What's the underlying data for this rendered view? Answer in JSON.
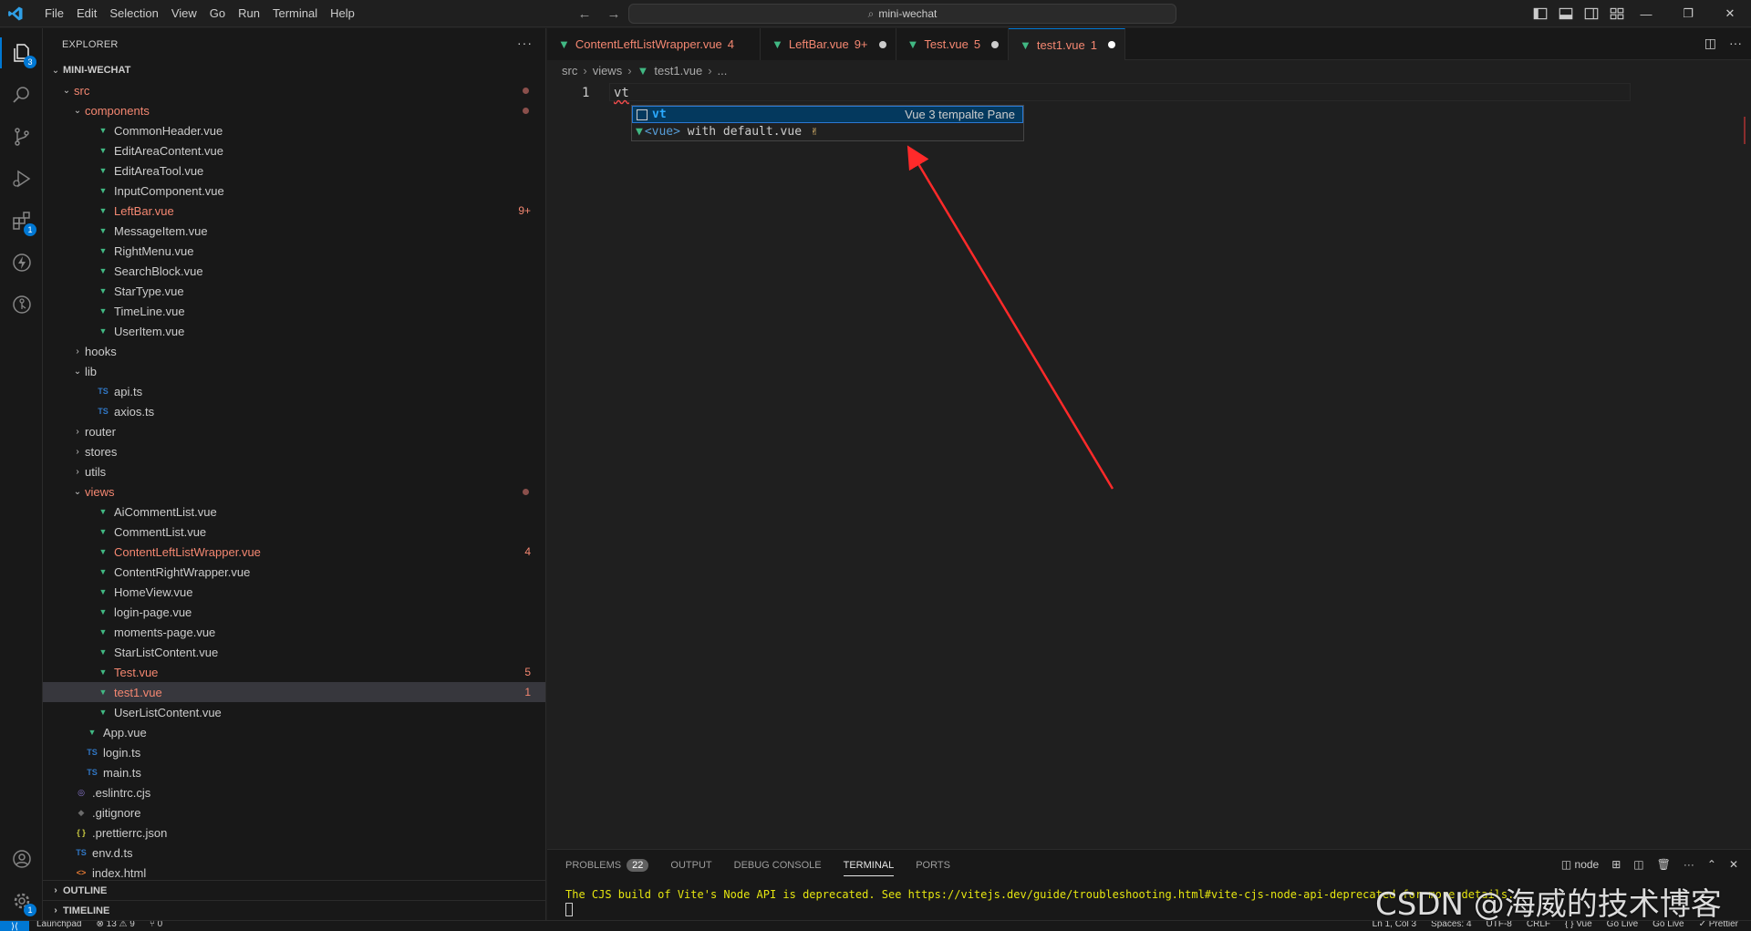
{
  "menubar": [
    "File",
    "Edit",
    "Selection",
    "View",
    "Go",
    "Run",
    "Terminal",
    "Help"
  ],
  "command_center": {
    "text": "mini-wechat"
  },
  "activity_badges": {
    "explorer": "3",
    "extensions": "1"
  },
  "explorer": {
    "title": "EXPLORER",
    "more": "···",
    "project": "MINI-WECHAT",
    "rows": [
      {
        "label": "src",
        "indent": 1,
        "kind": "folder-open",
        "err": true,
        "dot": true
      },
      {
        "label": "components",
        "indent": 2,
        "kind": "folder-open",
        "err": true,
        "dot": true
      },
      {
        "label": "CommonHeader.vue",
        "indent": 3,
        "kind": "vue"
      },
      {
        "label": "EditAreaContent.vue",
        "indent": 3,
        "kind": "vue"
      },
      {
        "label": "EditAreaTool.vue",
        "indent": 3,
        "kind": "vue"
      },
      {
        "label": "InputComponent.vue",
        "indent": 3,
        "kind": "vue"
      },
      {
        "label": "LeftBar.vue",
        "indent": 3,
        "kind": "vue",
        "err": true,
        "badge": "9+"
      },
      {
        "label": "MessageItem.vue",
        "indent": 3,
        "kind": "vue"
      },
      {
        "label": "RightMenu.vue",
        "indent": 3,
        "kind": "vue"
      },
      {
        "label": "SearchBlock.vue",
        "indent": 3,
        "kind": "vue"
      },
      {
        "label": "StarType.vue",
        "indent": 3,
        "kind": "vue"
      },
      {
        "label": "TimeLine.vue",
        "indent": 3,
        "kind": "vue"
      },
      {
        "label": "UserItem.vue",
        "indent": 3,
        "kind": "vue"
      },
      {
        "label": "hooks",
        "indent": 2,
        "kind": "folder-closed"
      },
      {
        "label": "lib",
        "indent": 2,
        "kind": "folder-open"
      },
      {
        "label": "api.ts",
        "indent": 3,
        "kind": "ts"
      },
      {
        "label": "axios.ts",
        "indent": 3,
        "kind": "ts"
      },
      {
        "label": "router",
        "indent": 2,
        "kind": "folder-closed"
      },
      {
        "label": "stores",
        "indent": 2,
        "kind": "folder-closed"
      },
      {
        "label": "utils",
        "indent": 2,
        "kind": "folder-closed"
      },
      {
        "label": "views",
        "indent": 2,
        "kind": "folder-open",
        "err": true,
        "dot": true
      },
      {
        "label": "AiCommentList.vue",
        "indent": 3,
        "kind": "vue"
      },
      {
        "label": "CommentList.vue",
        "indent": 3,
        "kind": "vue"
      },
      {
        "label": "ContentLeftListWrapper.vue",
        "indent": 3,
        "kind": "vue",
        "err": true,
        "badge": "4"
      },
      {
        "label": "ContentRightWrapper.vue",
        "indent": 3,
        "kind": "vue"
      },
      {
        "label": "HomeView.vue",
        "indent": 3,
        "kind": "vue"
      },
      {
        "label": "login-page.vue",
        "indent": 3,
        "kind": "vue"
      },
      {
        "label": "moments-page.vue",
        "indent": 3,
        "kind": "vue"
      },
      {
        "label": "StarListContent.vue",
        "indent": 3,
        "kind": "vue"
      },
      {
        "label": "Test.vue",
        "indent": 3,
        "kind": "vue",
        "err": true,
        "badge": "5"
      },
      {
        "label": "test1.vue",
        "indent": 3,
        "kind": "vue",
        "err": true,
        "badge": "1",
        "selected": true
      },
      {
        "label": "UserListContent.vue",
        "indent": 3,
        "kind": "vue"
      },
      {
        "label": "App.vue",
        "indent": 2,
        "kind": "vue"
      },
      {
        "label": "login.ts",
        "indent": 2,
        "kind": "ts"
      },
      {
        "label": "main.ts",
        "indent": 2,
        "kind": "ts"
      },
      {
        "label": ".eslintrc.cjs",
        "indent": 1,
        "kind": "eslint"
      },
      {
        "label": ".gitignore",
        "indent": 1,
        "kind": "git"
      },
      {
        "label": ".prettierrc.json",
        "indent": 1,
        "kind": "json"
      },
      {
        "label": "env.d.ts",
        "indent": 1,
        "kind": "ts"
      },
      {
        "label": "index.html",
        "indent": 1,
        "kind": "html"
      }
    ],
    "sections": [
      "OUTLINE",
      "TIMELINE"
    ]
  },
  "tabs": [
    {
      "label": "ContentLeftListWrapper.vue",
      "num": "4",
      "dot": false,
      "active": false
    },
    {
      "label": "LeftBar.vue",
      "num": "9+",
      "dot": true,
      "active": false
    },
    {
      "label": "Test.vue",
      "num": "5",
      "dot": true,
      "active": false
    },
    {
      "label": "test1.vue",
      "num": "1",
      "dot": true,
      "active": true
    }
  ],
  "breadcrumb": {
    "p1": "src",
    "p2": "views",
    "p3": "test1.vue",
    "p4": "..."
  },
  "code": {
    "line_number": "1",
    "text": "vt"
  },
  "suggest": {
    "item1": {
      "label": "vt",
      "detail": "Vue 3 tempalte Pane"
    },
    "item2": {
      "tag": "<vue>",
      "rest": " with default.vue",
      "emoji": "✌"
    }
  },
  "panel": {
    "tabs": [
      "PROBLEMS",
      "OUTPUT",
      "DEBUG CONSOLE",
      "TERMINAL",
      "PORTS"
    ],
    "problems_count": "22",
    "active_tab": "TERMINAL",
    "terminal_name": "node",
    "terminal_text": "The CJS build of Vite's Node API is deprecated. See https://vitejs.dev/guide/troubleshooting.html#vite-cjs-node-api-deprecated for more details."
  },
  "watermark": "CSDN @海威的技术博客",
  "statusbar": {
    "left": [
      "Launchpad",
      "⊗ 13 ⚠ 9",
      "⑂ 0"
    ],
    "right": [
      "Ln 1, Col 3",
      "Spaces: 4",
      "UTF-8",
      "CRLF",
      "{ } Vue",
      "Go Live",
      "Go Live",
      "✓ Prettier"
    ]
  },
  "colors": {
    "accent": "#0078d4",
    "error": "#f48771",
    "vue": "#41b883",
    "arrow": "#ff2a2a"
  }
}
